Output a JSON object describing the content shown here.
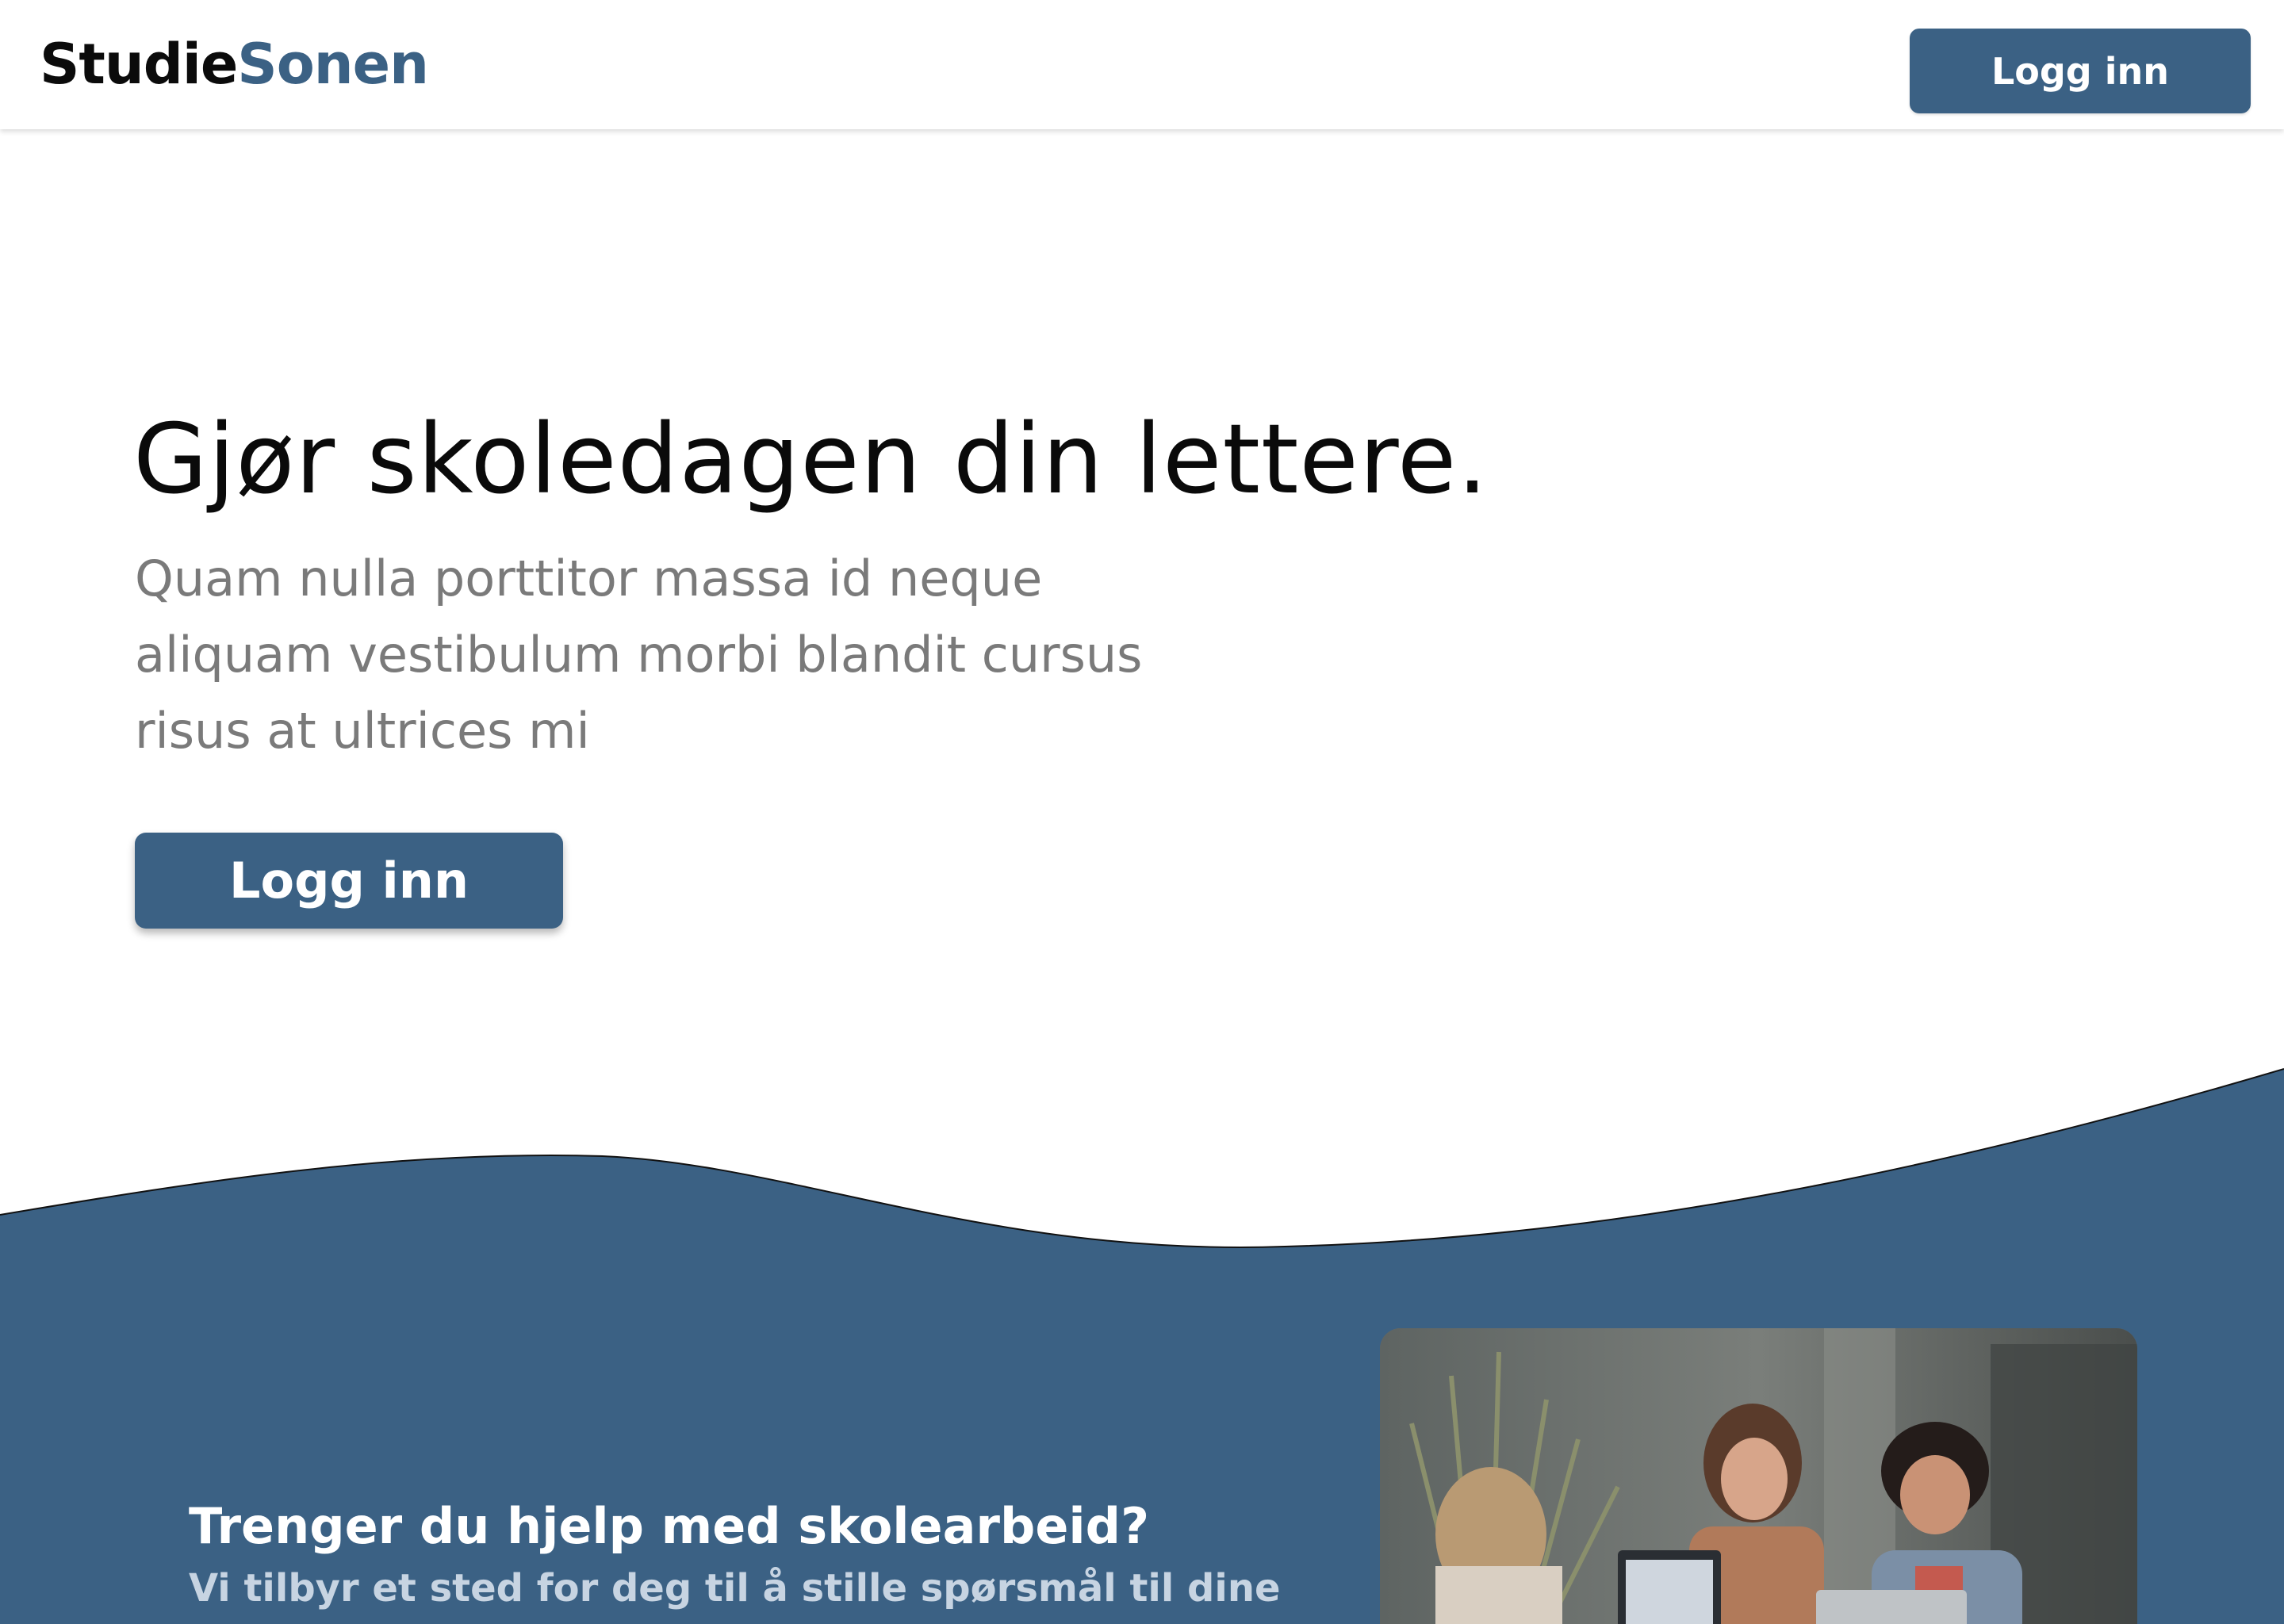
{
  "header": {
    "logo_part1": "Studie",
    "logo_part2": "Sonen",
    "login_label": "Logg inn"
  },
  "hero": {
    "title": "Gjør skoledagen din lettere.",
    "subtitle": "Quam nulla porttitor massa id neque aliquam vestibulum morbi blandit cursus risus at ultrices mi",
    "login_label": "Logg inn"
  },
  "info": {
    "title": "Trenger du hjelp med skolearbeid?",
    "text": "Vi tilbyr et sted for deg til å stille spørsmål til dine"
  },
  "colors": {
    "brand": "#3b6184",
    "text_dark": "#0a0a0a",
    "text_muted": "#7a7a7a",
    "info_text": "#c7d4e2"
  },
  "icons": {
    "photo": "students-laughing-photo"
  }
}
